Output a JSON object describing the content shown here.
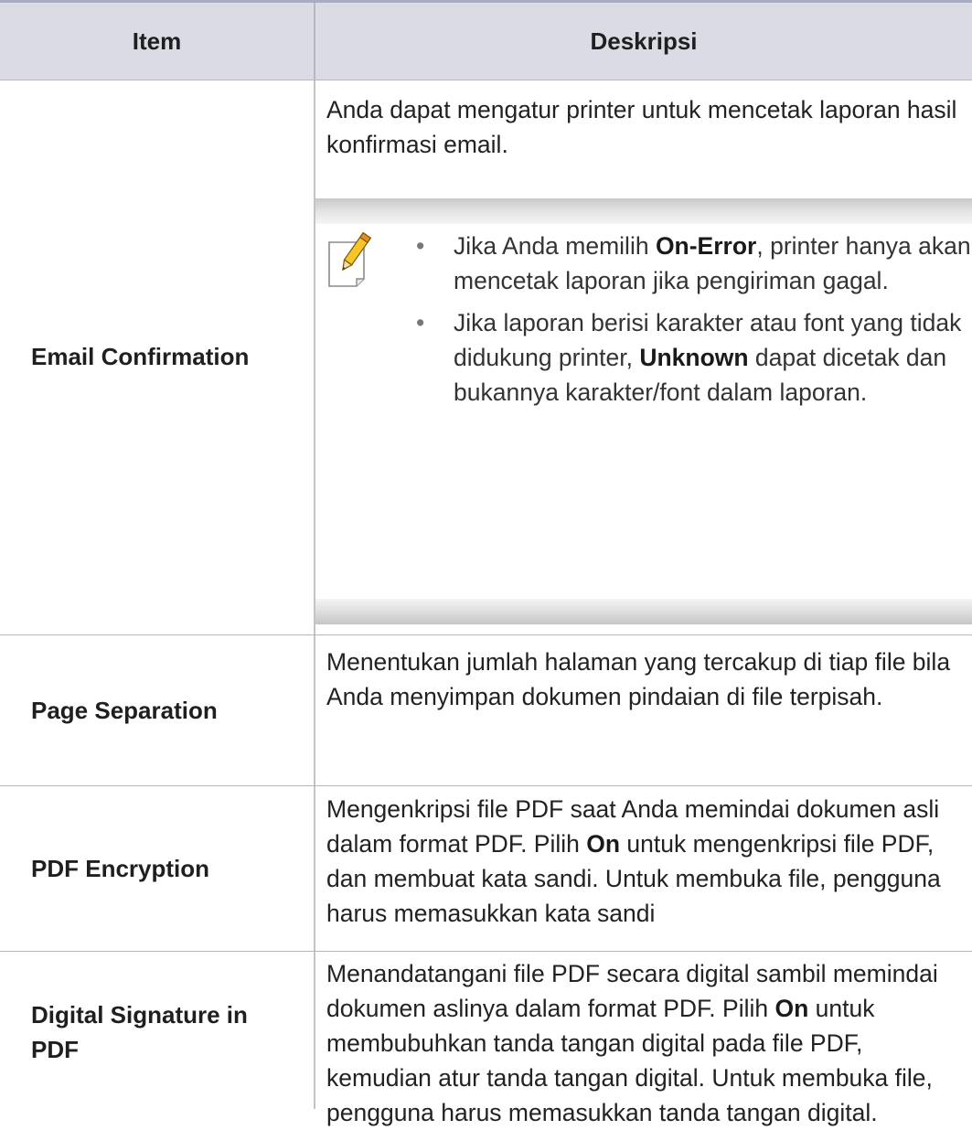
{
  "header": {
    "item": "Item",
    "description": "Deskripsi"
  },
  "rows": [
    {
      "item": "Email Confirmation",
      "desc": "Anda dapat mengatur printer untuk mencetak laporan hasil konfirmasi email.",
      "note": {
        "icon": "note-pencil-icon",
        "bullets": [
          {
            "pre": "Jika Anda memilih ",
            "bold": "On-Error",
            "post": ", printer hanya akan mencetak laporan jika pengiriman gagal."
          },
          {
            "pre": "Jika laporan berisi karakter atau font yang tidak didukung printer, ",
            "bold": "Unknown",
            "post": " dapat dicetak dan bukannya karakter/font dalam laporan."
          }
        ]
      }
    },
    {
      "item": "Page Separation",
      "desc": "Menentukan jumlah halaman yang tercakup di tiap file bila Anda menyimpan dokumen pindaian di file terpisah."
    },
    {
      "item": "PDF Encryption",
      "desc_pre": "Mengenkripsi file PDF saat Anda memindai dokumen asli dalam format PDF. Pilih ",
      "desc_bold": "On",
      "desc_post": " untuk mengenkripsi file PDF, dan membuat kata sandi. Untuk membuka file, pengguna harus memasukkan kata sandi"
    },
    {
      "item": "Digital Signature in PDF",
      "desc_pre": "Menandatangani file PDF secara digital sambil memindai dokumen aslinya dalam format PDF. Pilih ",
      "desc_bold": "On",
      "desc_post": " untuk membubuhkan tanda tangan digital pada file PDF, kemudian atur tanda tangan digital. Untuk membuka file, pengguna harus memasukkan tanda tangan digital."
    }
  ],
  "colors": {
    "header_bg": "#dadbe4",
    "header_top_rule": "#a9abc2",
    "grid_line": "#c4c4c4"
  }
}
